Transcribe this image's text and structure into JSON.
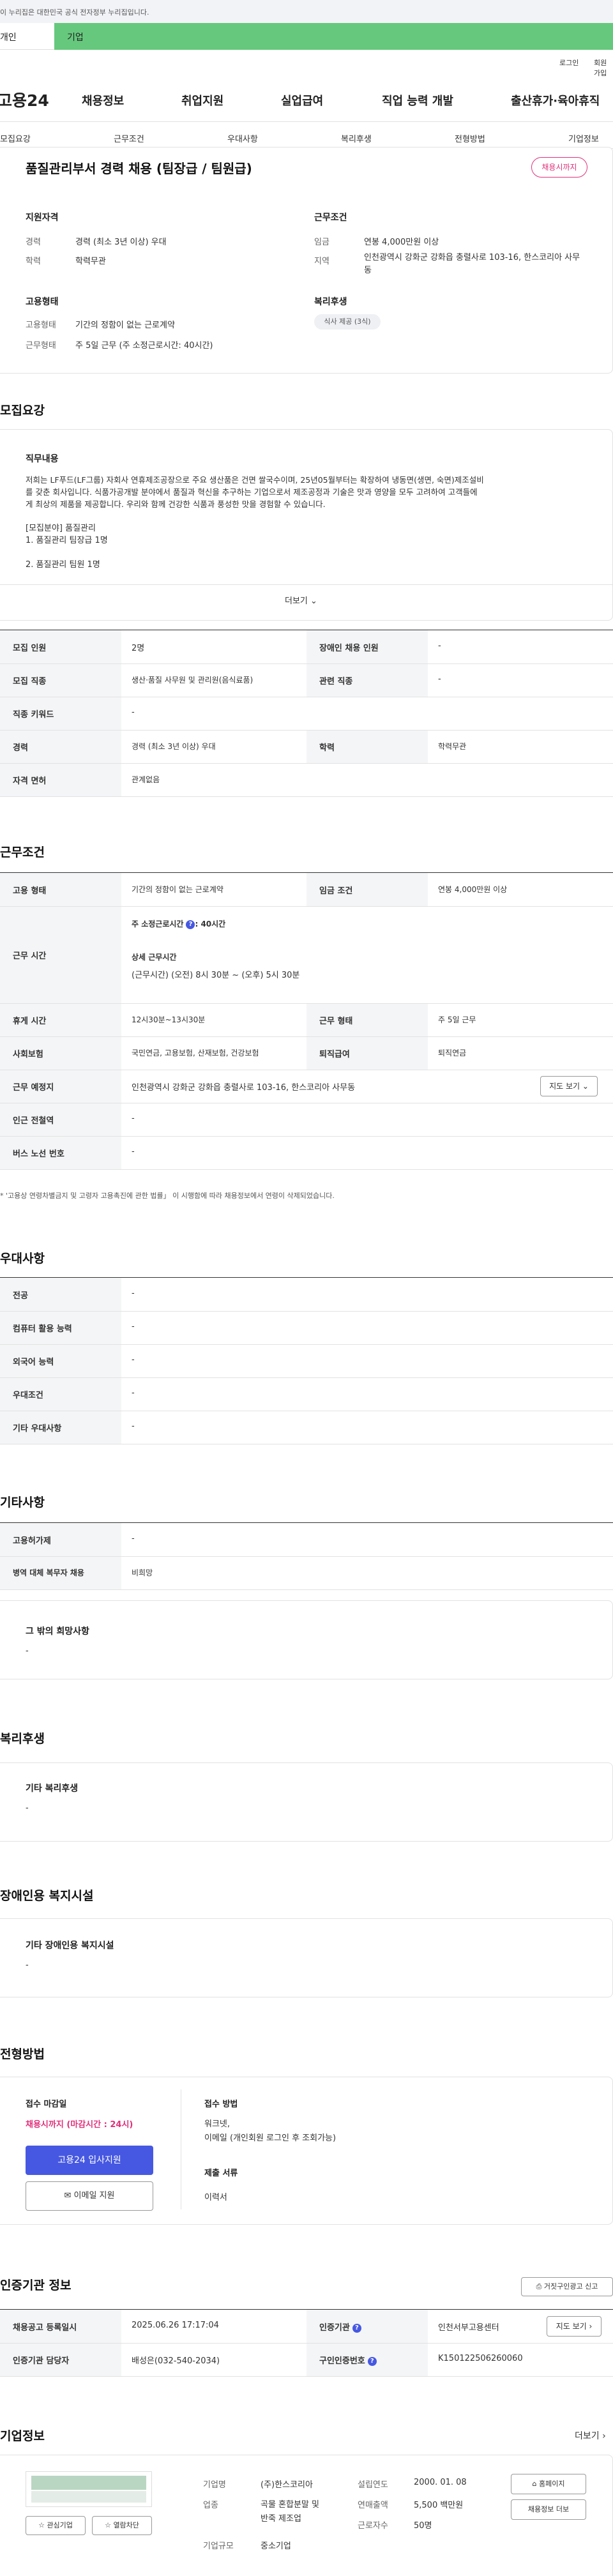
{
  "gov_banner": "이 누리집은 대한민국 공식 전자정부 누리집입니다.",
  "tabs": [
    "개인",
    "기업"
  ],
  "util": [
    "로그인",
    "회원가입"
  ],
  "logo": "고용24",
  "gnb": [
    "채용정보",
    "취업지원",
    "실업급여",
    "직업 능력 개발",
    "출산휴가·육아휴직"
  ],
  "subnav": [
    "모집요강",
    "근무조건",
    "우대사항",
    "복리후생",
    "전형방법",
    "기업정보"
  ],
  "job_title": "품질관리부서 경력 채용 (팀장급 / 팀원급)",
  "status_badge": "채용시까지",
  "summary": {
    "qual_title": "지원자격",
    "career_label": "경력",
    "career_value": "경력 (최소 3년 이상) 우대",
    "edu_label": "학력",
    "edu_value": "학력무관",
    "cond_title": "근무조건",
    "wage_label": "임금",
    "wage_value": "연봉 4,000만원 이상",
    "region_label": "지역",
    "region_value": "인천광역시 강화군 강화읍 충렬사로 103-16, 한스코리아 사무동",
    "emp_title": "고용형태",
    "emptype_label": "고용형태",
    "emptype_value": "기간의 정함이 없는 근로계약",
    "worktype_label": "근무형태",
    "worktype_value": "주 5일 근무 (주 소정근로시간: 40시간)",
    "welfare_title": "복리후생",
    "welfare_chip": "식사 제공 (3식)"
  },
  "recruit": {
    "title": "모집요강",
    "desc_title": "직무내용",
    "desc_lines": [
      "저희는 LF푸드(LF그룹) 자회사 연휴제조공장으로 주요 생산품은 건면 쌀국수이며, 25년05월부터는 확장하여 냉동면(생면, 숙면)제조설비",
      "를 갖춘 회사입니다. 식품가공개발 분야에서 품질과 혁신을 추구하는 기업으로서 제조공정과 기술은 맛과 영양을 모두 고려하여 고객들에",
      "게 최상의 제품을 제공합니다. 우리와 함께 건강한 식품과 풍성한 맛을 경험할 수 있습니다.",
      "",
      "[모집분야] 품질관리",
      "1. 품질관리 팀장급 1명",
      "",
      "2. 품질관리 팀원 1명"
    ],
    "more": "더보기",
    "rows": [
      {
        "l1": "모집 인원",
        "v1": "2명",
        "l2": "장애인 채용 인원",
        "v2": "-"
      },
      {
        "l1": "모집 직종",
        "v1": "생산·품질 사무원 및 관리원(음식료품)",
        "l2": "관련 직종",
        "v2": "-"
      },
      {
        "l1": "직종 키워드",
        "v1": "-"
      },
      {
        "l1": "경력",
        "v1": "경력 (최소 3년 이상) 우대",
        "l2": "학력",
        "v2": "학력무관"
      },
      {
        "l1": "자격 면허",
        "v1": "관계없음"
      }
    ]
  },
  "conditions": {
    "title": "근무조건",
    "emptype_label": "고용 형태",
    "emptype": "기간의 정함이 없는 근로계약",
    "wage_label": "임금 조건",
    "wage": "연봉 4,000만원 이상",
    "hours_label": "근무 시간",
    "hours_main": "주 소정근로시간",
    "hours_main_val": ": 40시간",
    "hours_detail_title": "상세 근무시간",
    "hours_detail": "(근무시간) (오전) 8시 30분 ~ (오후) 5시 30분",
    "break_label": "휴게 시간",
    "break": "12시30분~13시30분",
    "worktype_label": "근무 형태",
    "worktype": "주 5일 근무",
    "insurance_label": "사회보험",
    "insurance": "국민연금, 고용보험, 산재보험, 건강보험",
    "severance_label": "퇴직급여",
    "severance": "퇴직연금",
    "place_label": "근무 예정지",
    "place": "인천광역시 강화군 강화읍 충렬사로 103-16, 한스코리아 사무동",
    "map_btn": "지도 보기",
    "subway_label": "인근 전철역",
    "subway": "-",
    "bus_label": "버스 노선 번호",
    "bus": "-",
    "note": "* '고용상 연령차별금지 및 고령자 고용촉진에 관한 법률」 이 시행함에 따라 채용정보에서 연령이 삭제되었습니다."
  },
  "preference": {
    "title": "우대사항",
    "rows": [
      {
        "l": "전공",
        "v": "-"
      },
      {
        "l": "컴퓨터 활용 능력",
        "v": "-"
      },
      {
        "l": "외국어 능력",
        "v": "-"
      },
      {
        "l": "우대조건",
        "v": "-"
      },
      {
        "l": "기타 우대사항",
        "v": "-"
      }
    ]
  },
  "etc": {
    "title": "기타사항",
    "rows": [
      {
        "l": "고용허가제",
        "v": "-"
      },
      {
        "l": "병역 대체 복무자 채용",
        "v": "비희망"
      }
    ],
    "hope_title": "그 밖의 희망사항",
    "hope_val": "-"
  },
  "welfare": {
    "title": "복리후생",
    "box_title": "기타 복리후생",
    "box_val": "-"
  },
  "disabled": {
    "title": "장애인용 복지시설",
    "box_title": "기타 장애인용 복지시설",
    "box_val": "-"
  },
  "process": {
    "title": "전형방법",
    "deadline_title": "접수 마감일",
    "deadline": "채용시까지 (마감시간 : 24시)",
    "apply_btn": "고용24 입사지원",
    "email_btn": "이메일 지원",
    "method_title": "접수 방법",
    "method_lines": [
      "워크넷,",
      "이메일 (개인회원 로그인 후 조회가능)"
    ],
    "docs_title": "제출 서류",
    "docs": "이력서"
  },
  "agency": {
    "title": "인증기관 정보",
    "report_btn": "거짓구인광고 신고",
    "reg_label": "채용공고 등록일시",
    "reg": "2025.06.26 17:17:04",
    "agency_label": "인증기관",
    "agency": "인천서부고용센터",
    "map_btn": "지도 보기",
    "staff_label": "인증기관 담당자",
    "staff": "배성은(032-540-2034)",
    "id_label": "구인인증번호",
    "id": "K150122506260060"
  },
  "company": {
    "title": "기업정보",
    "more": "더보기",
    "name_label": "기업명",
    "name": "(주)한스코리아",
    "industry_label": "업종",
    "industry_lines": [
      "곡물 혼합분말 및",
      "반죽 제조업"
    ],
    "size_label": "기업규모",
    "size": "중소기업",
    "founded_label": "설립연도",
    "founded": "2000. 01. 08",
    "sales_label": "연매출액",
    "sales": "5,500 백만원",
    "staff_label": "근로자수",
    "staff": "50명",
    "home_btn": "홈페이지",
    "detail_btn": "채용정보 더보",
    "fav_btn": "관심기업",
    "block_btn": "열람차단"
  },
  "colors": {
    "accent": "#4658e2",
    "pink": "#e0307a",
    "green": "#66c87d"
  }
}
